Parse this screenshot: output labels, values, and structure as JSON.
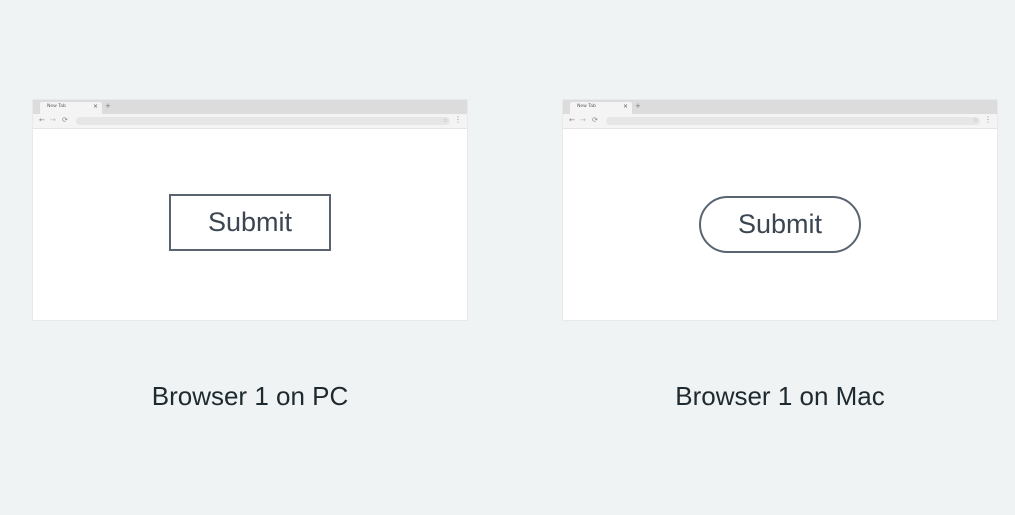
{
  "browsers": [
    {
      "tab_title": "New Tab",
      "tab_close": "×",
      "new_tab": "+",
      "nav": {
        "back": "←",
        "forward": "→",
        "reload": "⟳",
        "bookmark": "☆",
        "menu": "⋮"
      },
      "button_label": "Submit",
      "button_style": "square",
      "caption": "Browser 1 on PC"
    },
    {
      "tab_title": "New Tab",
      "tab_close": "×",
      "new_tab": "+",
      "nav": {
        "back": "←",
        "forward": "→",
        "reload": "⟳",
        "bookmark": "☆",
        "menu": "⋮"
      },
      "button_label": "Submit",
      "button_style": "rounded",
      "caption": "Browser 1 on Mac"
    }
  ],
  "colors": {
    "background": "#eff3f3",
    "button_border": "#5a6470",
    "button_text": "#3c4650",
    "caption_text": "#1f2a30"
  }
}
